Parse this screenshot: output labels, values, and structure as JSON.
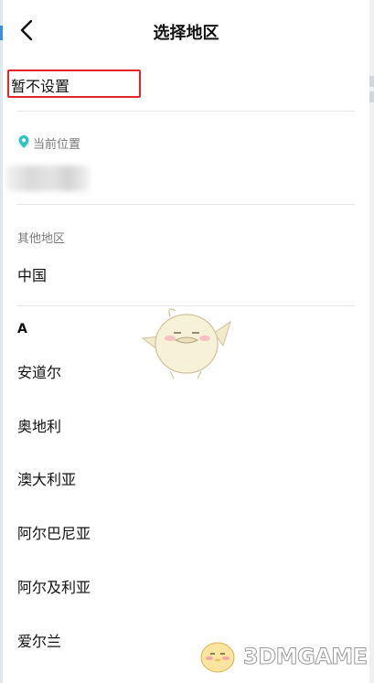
{
  "header": {
    "title": "选择地区"
  },
  "unset_option": {
    "label": "暂不设置"
  },
  "current_location": {
    "label": "当前位置",
    "value": ""
  },
  "other_regions": {
    "label": "其他地区",
    "items": [
      "中国"
    ]
  },
  "alphabet_section": {
    "letter": "A",
    "countries": [
      "安道尔",
      "奥地利",
      "澳大利亚",
      "阿尔巴尼亚",
      "阿尔及利亚",
      "爱尔兰"
    ]
  },
  "watermark": {
    "text": "3DMGAME"
  },
  "colors": {
    "highlight": "#e4262c",
    "pin": "#2ec4c4",
    "divider": "#e6e6e6",
    "secondary_text": "#7a7a7a"
  },
  "icons": {
    "back": "chevron-left-icon",
    "pin": "location-pin-icon"
  }
}
